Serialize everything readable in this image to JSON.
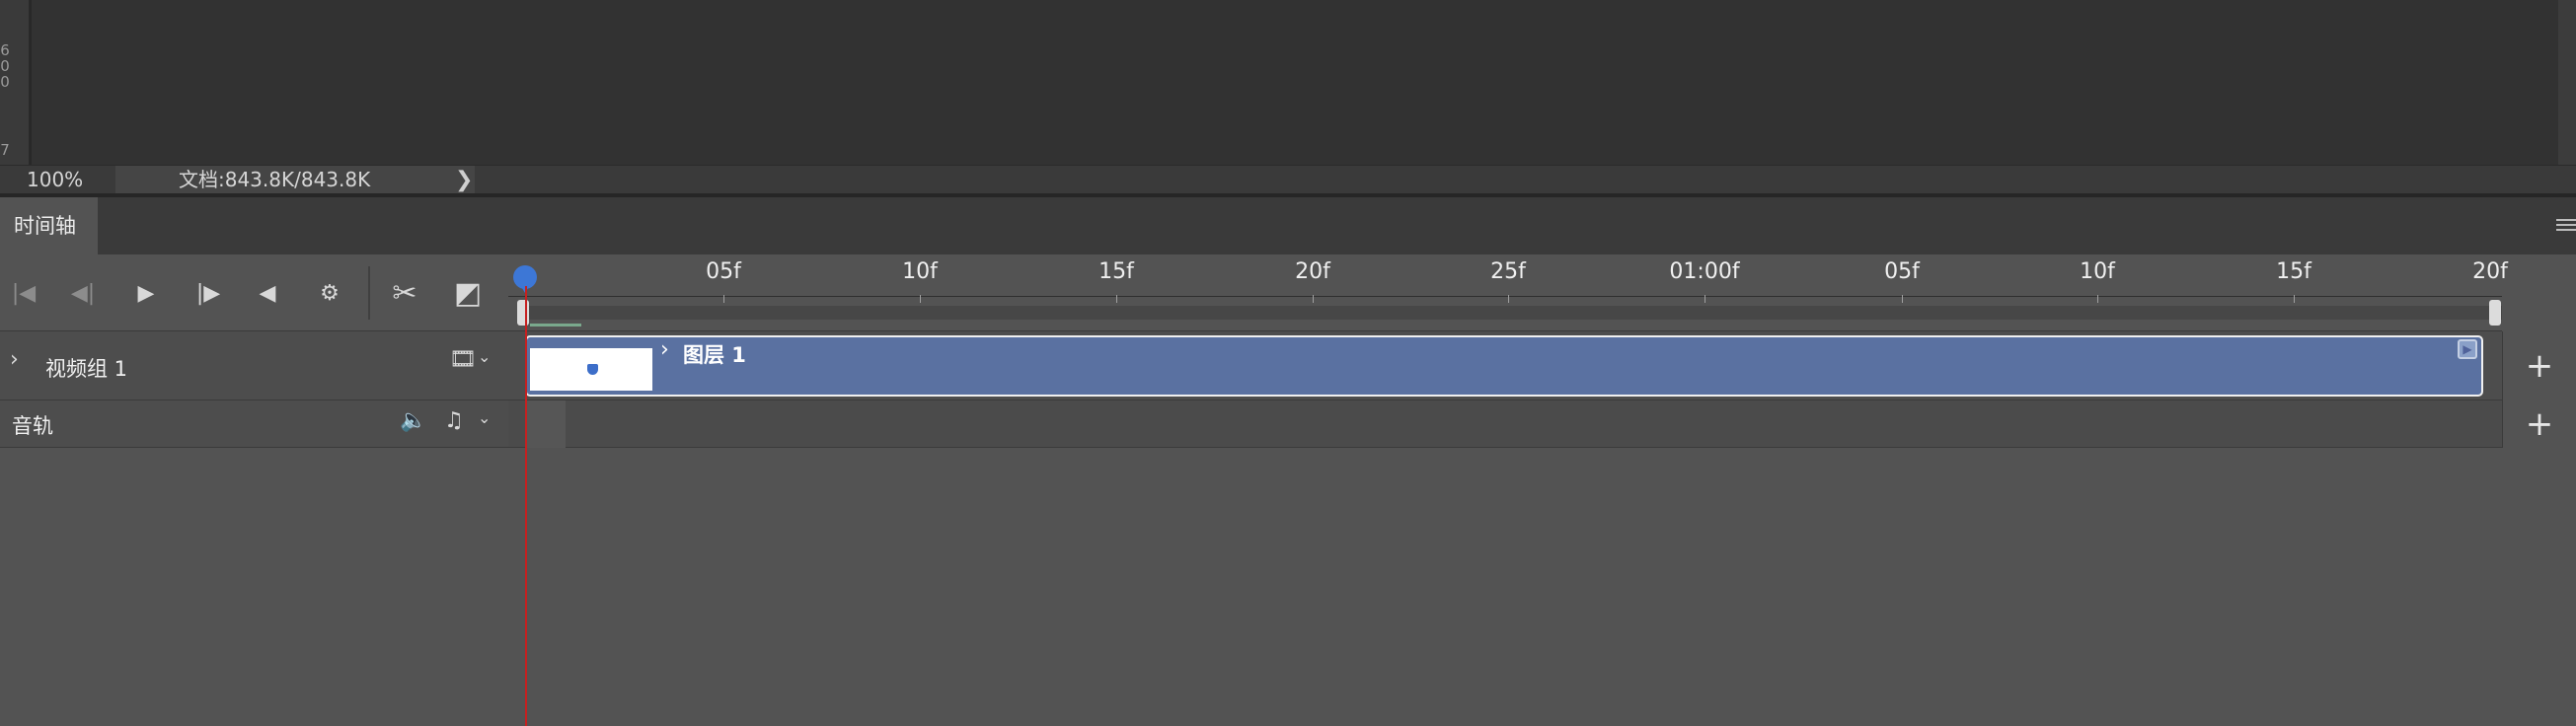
{
  "canvas": {
    "ruler_ticks": [
      "6",
      "0",
      "0",
      "7"
    ]
  },
  "status": {
    "zoom": "100%",
    "doc_info": "文档:843.8K/843.8K",
    "arrow": "❯"
  },
  "panel": {
    "tab_label": "时间轴"
  },
  "controls": {
    "first_frame": "|◀",
    "prev_frame": "◀|",
    "play": "▶",
    "next_frame": "|▶",
    "audio": "◀",
    "settings": "⚙",
    "split": "✂",
    "transition": "◩"
  },
  "ruler": {
    "labels": [
      "05f",
      "10f",
      "15f",
      "20f",
      "25f",
      "01:00f",
      "05f",
      "10f",
      "15f",
      "20f"
    ]
  },
  "tracks": {
    "video_group_label": "视频组 1",
    "audio_track_label": "音轨",
    "clip_label": "图层 1",
    "add_symbol": "+"
  }
}
